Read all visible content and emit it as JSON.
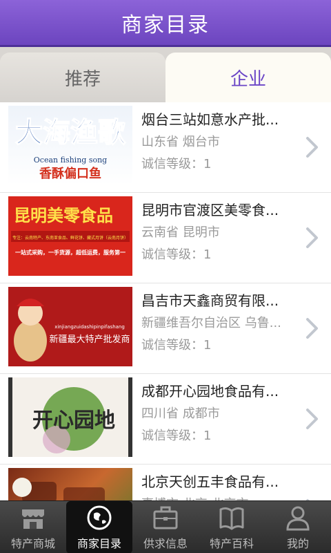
{
  "header": {
    "title": "商家目录"
  },
  "tabs": [
    {
      "label": "推荐",
      "active": false
    },
    {
      "label": "企业",
      "active": true
    }
  ],
  "companies": [
    {
      "name": "烟台三站如意水产批...",
      "location": "山东省 烟台市",
      "grade": "诚信等级：1",
      "thumb": {
        "title": "大海渔歌",
        "subtitle": "Ocean fishing song",
        "caption": "香酥偏口鱼"
      }
    },
    {
      "name": "昆明市官渡区美零食...",
      "location": "云南省 昆明市",
      "grade": "诚信等级：1",
      "thumb": {
        "title": "昆明美零食品",
        "line1": "专注：云南特产、东南亚食品、鲜花饼、藏式月饼（云南月饼）",
        "line2": "一站式采购，一手货源，超低运费，服务第一"
      }
    },
    {
      "name": "昌吉市天鑫商贸有限...",
      "location": "新疆维吾尔自治区 乌鲁...",
      "grade": "诚信等级：1",
      "thumb": {
        "line1": "xinjiangzuidashipinpifashang",
        "line2": "新疆最大特产批发商"
      }
    },
    {
      "name": "成都开心园地食品有...",
      "location": "四川省 成都市",
      "grade": "诚信等级：1",
      "thumb": {
        "title": "开心园地"
      }
    },
    {
      "name": "北京天创五丰食品有...",
      "location": "事博市 北京 北京市",
      "grade": "",
      "thumb": {}
    }
  ],
  "nav": [
    {
      "label": "特产商城",
      "icon": "store-icon",
      "active": false
    },
    {
      "label": "商家目录",
      "icon": "globe-icon",
      "active": true
    },
    {
      "label": "供求信息",
      "icon": "briefcase-icon",
      "active": false
    },
    {
      "label": "特产百科",
      "icon": "book-icon",
      "active": false
    },
    {
      "label": "我的",
      "icon": "user-icon",
      "active": false
    }
  ],
  "colors": {
    "header": "#7a52cc",
    "tab_active_text": "#6a45c6",
    "nav_bg": "#3a3a3a"
  }
}
